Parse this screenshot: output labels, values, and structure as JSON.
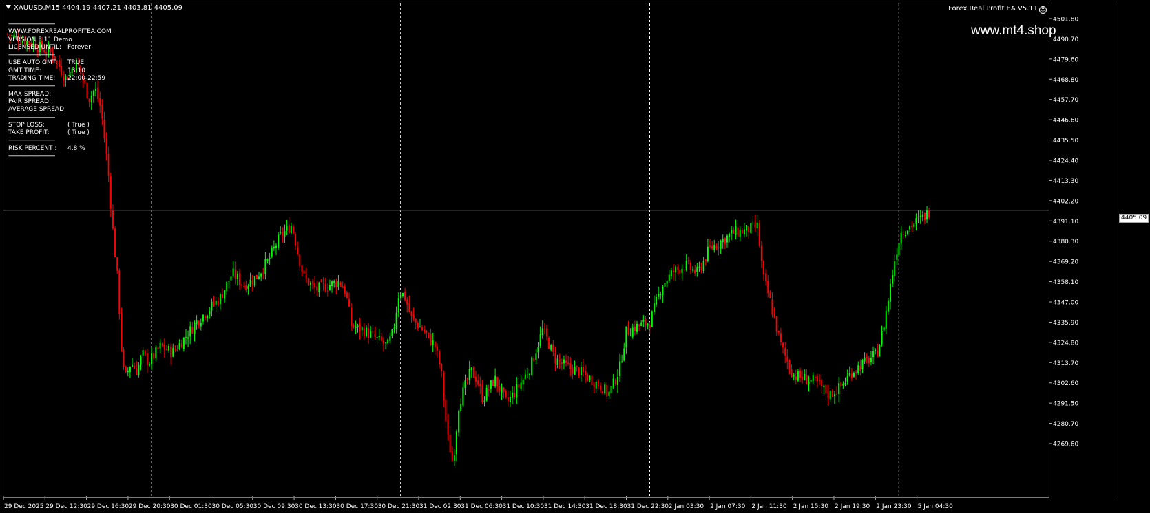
{
  "chart": {
    "symbol_line": "XAUUSD,M15  4404.19 4407.21 4403.81 4405.09",
    "ea_label": "Forex Real Profit EA V5.11",
    "ea_icon": "smiley-icon",
    "watermark": "www.mt4.shop",
    "current_price": "4405.09",
    "colors": {
      "background": "#000000",
      "bull": "#00ff00",
      "bear": "#ff0000",
      "grid": "#ffffff",
      "price_line": "#808080"
    }
  },
  "info_panel": {
    "separator": "------------------------------",
    "site": "WWW.FOREXREALPROFITEA.COM",
    "version": "VERSION 5.11 Demo",
    "license_label": "LICENSED UNTIL:",
    "license_value": "Forever",
    "auto_gmt_label": "USE AUTO GMT:",
    "auto_gmt_value": "TRUE",
    "gmt_time_label": "GMT TIME:",
    "gmt_time_value": "13:10",
    "trading_time_label": "TRADING TIME:",
    "trading_time_value": "22:00-22:59",
    "max_spread_label": "MAX SPREAD:",
    "pair_spread_label": "PAIR SPREAD:",
    "avg_spread_label": "AVERAGE SPREAD:",
    "stop_loss_label": "STOP LOSS:",
    "stop_loss_value": "( True )",
    "take_profit_label": "TAKE PROFIT:",
    "take_profit_value": "( True )",
    "risk_label": "RISK PERCENT :",
    "risk_value": "4.8 %"
  },
  "chart_data": {
    "type": "candlestick",
    "ylim": [
      4264.0,
      4507.0
    ],
    "y_ticks": [
      "4501.80",
      "4490.70",
      "4479.60",
      "4468.80",
      "4457.70",
      "4446.60",
      "4435.50",
      "4424.40",
      "4413.30",
      "4402.20",
      "4391.10",
      "4380.30",
      "4369.20",
      "4358.10",
      "4347.00",
      "4335.90",
      "4324.80",
      "4313.70",
      "4302.60",
      "4291.50",
      "4280.70",
      "4269.60"
    ],
    "x_ticks": [
      "29 Dec 2025",
      "29 Dec 12:30",
      "29 Dec 16:30",
      "29 Dec 20:30",
      "30 Dec 01:30",
      "30 Dec 05:30",
      "30 Dec 09:30",
      "30 Dec 13:30",
      "30 Dec 17:30",
      "30 Dec 21:30",
      "31 Dec 02:30",
      "31 Dec 06:30",
      "31 Dec 10:30",
      "31 Dec 14:30",
      "31 Dec 18:30",
      "31 Dec 22:30",
      "2 Jan 03:30",
      "2 Jan 07:30",
      "2 Jan 11:30",
      "2 Jan 15:30",
      "2 Jan 19:30",
      "2 Jan 23:30",
      "5 Jan 04:30"
    ],
    "day_separators_after_tick": [
      3,
      9,
      15,
      21
    ],
    "close_path": [
      [
        0,
        4492
      ],
      [
        2,
        4488
      ],
      [
        4,
        4482
      ],
      [
        5,
        4470
      ],
      [
        6,
        4478
      ],
      [
        7,
        4460
      ],
      [
        7.5,
        4465
      ],
      [
        8,
        4455
      ],
      [
        8.6,
        4425
      ],
      [
        9,
        4395
      ],
      [
        9.4,
        4370
      ],
      [
        9.8,
        4330
      ],
      [
        10,
        4322
      ],
      [
        10.5,
        4330
      ],
      [
        11,
        4326
      ],
      [
        11.5,
        4334
      ],
      [
        12,
        4330
      ],
      [
        13,
        4338
      ],
      [
        14,
        4335
      ],
      [
        15,
        4342
      ],
      [
        16,
        4350
      ],
      [
        17,
        4356
      ],
      [
        18,
        4362
      ],
      [
        19,
        4374
      ],
      [
        20,
        4368
      ],
      [
        21,
        4372
      ],
      [
        22,
        4380
      ],
      [
        23,
        4392
      ],
      [
        24,
        4398
      ],
      [
        24.5,
        4384
      ],
      [
        25,
        4372
      ],
      [
        26,
        4366
      ],
      [
        27,
        4368
      ],
      [
        28,
        4370
      ],
      [
        28.5,
        4365
      ],
      [
        29,
        4348
      ],
      [
        30,
        4346
      ],
      [
        31,
        4342
      ],
      [
        32,
        4338
      ],
      [
        32.5,
        4345
      ],
      [
        33,
        4366
      ],
      [
        33.5,
        4362
      ],
      [
        34,
        4352
      ],
      [
        35,
        4346
      ],
      [
        36,
        4338
      ],
      [
        36.5,
        4326
      ],
      [
        37,
        4295
      ],
      [
        37.5,
        4280
      ],
      [
        38,
        4310
      ],
      [
        39,
        4326
      ],
      [
        39.5,
        4322
      ],
      [
        40,
        4312
      ],
      [
        41,
        4322
      ],
      [
        42,
        4310
      ],
      [
        43,
        4318
      ],
      [
        44,
        4328
      ],
      [
        45,
        4346
      ],
      [
        45.5,
        4340
      ],
      [
        46,
        4332
      ],
      [
        47,
        4328
      ],
      [
        48,
        4326
      ],
      [
        49,
        4322
      ],
      [
        50,
        4318
      ],
      [
        50.5,
        4314
      ],
      [
        51,
        4320
      ],
      [
        51.5,
        4328
      ],
      [
        52,
        4345
      ],
      [
        53,
        4348
      ],
      [
        54,
        4350
      ],
      [
        55,
        4368
      ],
      [
        56,
        4375
      ],
      [
        57,
        4378
      ],
      [
        58,
        4374
      ],
      [
        59,
        4386
      ],
      [
        60,
        4390
      ],
      [
        61,
        4394
      ],
      [
        62,
        4395
      ],
      [
        63,
        4397
      ],
      [
        63.5,
        4372
      ],
      [
        64,
        4362
      ],
      [
        65,
        4338
      ],
      [
        66,
        4324
      ],
      [
        67,
        4322
      ],
      [
        68,
        4320
      ],
      [
        69,
        4314
      ],
      [
        70,
        4318
      ],
      [
        71,
        4326
      ],
      [
        72,
        4330
      ],
      [
        73,
        4334
      ],
      [
        73.5,
        4345
      ],
      [
        74,
        4362
      ],
      [
        74.5,
        4380
      ],
      [
        75,
        4394
      ],
      [
        76,
        4398
      ],
      [
        77,
        4402
      ],
      [
        77.5,
        4405
      ]
    ]
  }
}
